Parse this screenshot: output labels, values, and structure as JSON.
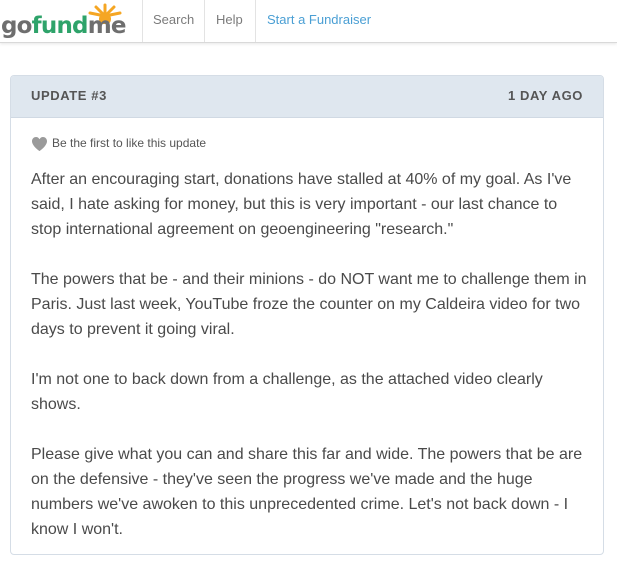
{
  "header": {
    "logo": {
      "part1": "go",
      "part2": "fund",
      "part3": "me"
    },
    "nav": {
      "search": "Search",
      "help": "Help",
      "start": "Start a Fundraiser"
    },
    "colors": {
      "brand_green": "#2ea36a",
      "sun_orange": "#f5a623",
      "link_blue": "#4a9fd4"
    }
  },
  "update": {
    "title": "UPDATE #3",
    "time": "1 DAY AGO",
    "like_icon": "heart-icon",
    "like_text": "Be the first to like this update",
    "paragraphs": [
      "After an encouraging start, donations have stalled at 40% of my goal. As I've said, I hate asking for money, but this is very important - our last chance to stop international agreement on geoengineering \"research.\"",
      "The powers that be - and their minions - do NOT want me to challenge them in Paris. Just last week, YouTube froze the counter on my Caldeira video for two days to prevent it going viral.",
      "I'm not one to back down from a challenge, as the attached video clearly shows.",
      "Please give what you can and share this far and wide. The powers that be are on the defensive - they've seen the progress we've made and the huge numbers we've awoken to this unprecedented crime. Let's not back down - I know I won't."
    ]
  }
}
